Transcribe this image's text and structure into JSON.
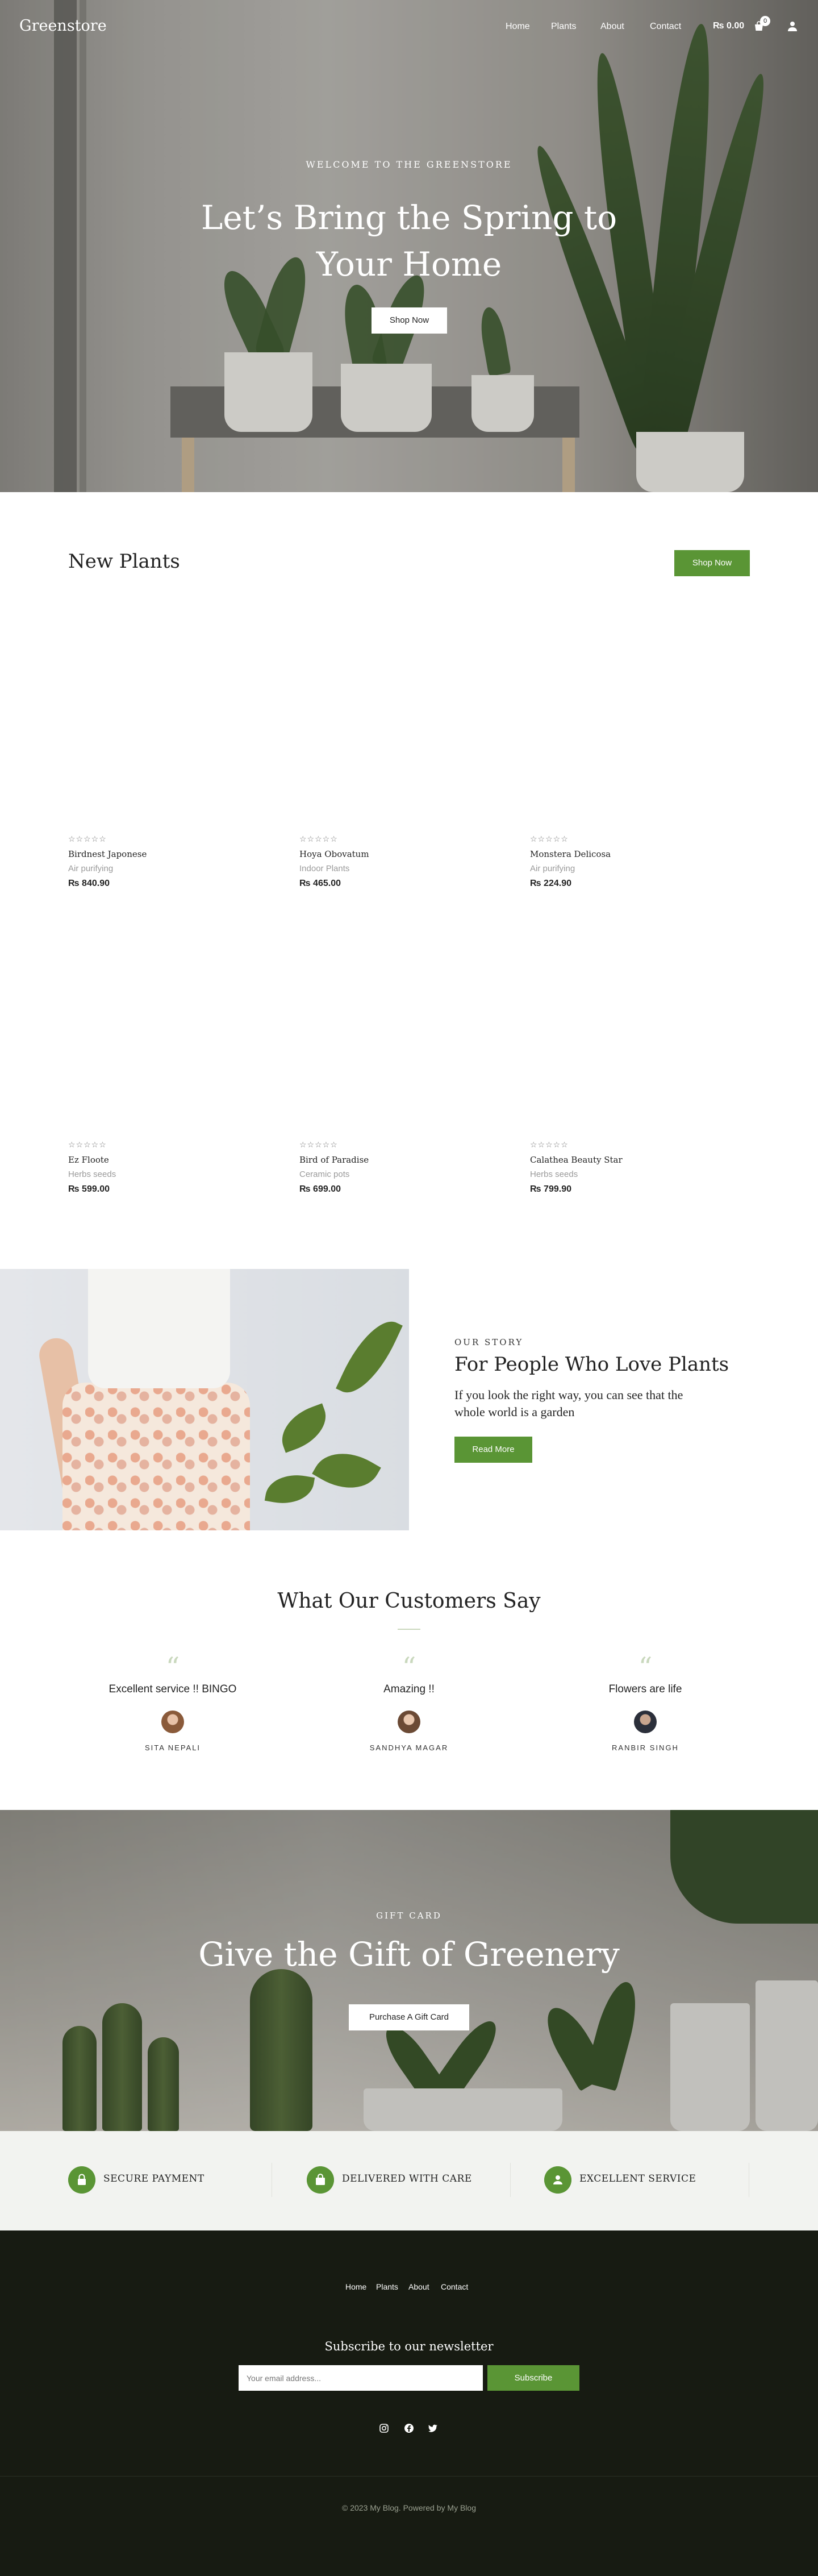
{
  "colors": {
    "accent": "#5a9535",
    "footer_bg": "#171b12",
    "features_bg": "#f2f3f0"
  },
  "header": {
    "logo": "Greenstore",
    "nav": [
      "Home",
      "Plants",
      "About",
      "Contact"
    ],
    "cart_total": "₨ 0.00",
    "cart_count": "0",
    "icons": [
      "cart-icon",
      "user-icon"
    ]
  },
  "hero": {
    "eyebrow": "WELCOME TO THE GREENSTORE",
    "title": "Let’s Bring the Spring to Your Home",
    "button": "Shop Now"
  },
  "new_plants": {
    "title": "New Plants",
    "button": "Shop Now",
    "products": [
      {
        "stars": "☆☆☆☆☆",
        "name": "Birdnest Japonese",
        "category": "Air purifying",
        "price": "₨ 840.90"
      },
      {
        "stars": "☆☆☆☆☆",
        "name": "Hoya Obovatum",
        "category": "Indoor Plants",
        "price": "₨ 465.00"
      },
      {
        "stars": "☆☆☆☆☆",
        "name": "Monstera Delicosa",
        "category": "Air purifying",
        "price": "₨ 224.90"
      },
      {
        "stars": "☆☆☆☆☆",
        "name": "Ez Floote",
        "category": "Herbs seeds",
        "price": "₨ 599.00"
      },
      {
        "stars": "☆☆☆☆☆",
        "name": "Bird of Paradise",
        "category": "Ceramic pots",
        "price": "₨ 699.00"
      },
      {
        "stars": "☆☆☆☆☆",
        "name": "Calathea Beauty Star",
        "category": "Herbs seeds",
        "price": "₨ 799.90"
      }
    ]
  },
  "story": {
    "eyebrow": "OUR STORY",
    "title": "For People Who Love Plants",
    "text": "If you look the right way, you can see that the whole world is a garden",
    "button": "Read More"
  },
  "testimonials": {
    "title": "What Our Customers Say",
    "items": [
      {
        "quote_mark": "“",
        "text": "Excellent service !! BINGO",
        "author": "SITA NEPALI"
      },
      {
        "quote_mark": "“",
        "text": "Amazing !!",
        "author": "SANDHYA MAGAR"
      },
      {
        "quote_mark": "“",
        "text": "Flowers are life",
        "author": "RANBIR SINGH"
      }
    ]
  },
  "gift": {
    "eyebrow": "GIFT CARD",
    "title": "Give the Gift of Greenery",
    "button": "Purchase A Gift Card"
  },
  "features": [
    {
      "icon": "lock-icon",
      "label": "SECURE PAYMENT"
    },
    {
      "icon": "bag-icon",
      "label": "DELIVERED WITH CARE"
    },
    {
      "icon": "support-icon",
      "label": "EXCELLENT SERVICE"
    }
  ],
  "footer": {
    "links": [
      "Home",
      "Plants",
      "About",
      "Contact"
    ],
    "newsletter_title": "Subscribe to our newsletter",
    "email_placeholder": "Your email address...",
    "subscribe": "Subscribe",
    "socials": [
      "instagram-icon",
      "facebook-icon",
      "twitter-icon"
    ],
    "copyright": "© 2023 My Blog. Powered by My Blog"
  }
}
